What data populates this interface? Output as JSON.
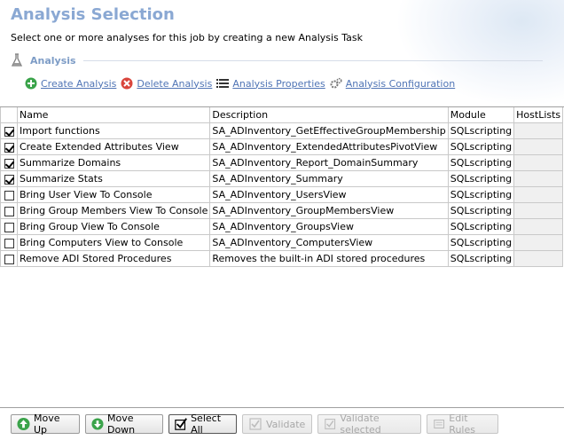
{
  "header": {
    "title": "Analysis Selection",
    "subtitle": "Select one or more analyses for this job by creating a new Analysis Task"
  },
  "section": {
    "label": "Analysis"
  },
  "toolbar": {
    "create": "Create Analysis",
    "delete": "Delete Analysis",
    "properties": "Analysis Properties",
    "configuration": "Analysis Configuration"
  },
  "grid": {
    "columns": [
      "Name",
      "Description",
      "Module",
      "HostLists"
    ],
    "rows": [
      {
        "checked": true,
        "name": "Import functions",
        "description": "SA_ADInventory_GetEffectiveGroupMembership",
        "module": "SQLscripting",
        "hostlists": ""
      },
      {
        "checked": true,
        "name": "Create Extended Attributes View",
        "description": "SA_ADInventory_ExtendedAttributesPivotView",
        "module": "SQLscripting",
        "hostlists": ""
      },
      {
        "checked": true,
        "name": "Summarize Domains",
        "description": "SA_ADInventory_Report_DomainSummary",
        "module": "SQLscripting",
        "hostlists": ""
      },
      {
        "checked": true,
        "name": "Summarize Stats",
        "description": "SA_ADInventory_Summary",
        "module": "SQLscripting",
        "hostlists": ""
      },
      {
        "checked": false,
        "name": "Bring User View To Console",
        "description": "SA_ADInventory_UsersView",
        "module": "SQLscripting",
        "hostlists": ""
      },
      {
        "checked": false,
        "name": "Bring Group Members View To Console",
        "description": "SA_ADInventory_GroupMembersView",
        "module": "SQLscripting",
        "hostlists": ""
      },
      {
        "checked": false,
        "name": "Bring Group View To Console",
        "description": "SA_ADInventory_GroupsView",
        "module": "SQLscripting",
        "hostlists": ""
      },
      {
        "checked": false,
        "name": "Bring Computers View to Console",
        "description": "SA_ADInventory_ComputersView",
        "module": "SQLscripting",
        "hostlists": ""
      },
      {
        "checked": false,
        "name": "Remove ADI Stored Procedures",
        "description": "Removes the built-in ADI stored procedures",
        "module": "SQLscripting",
        "hostlists": ""
      }
    ]
  },
  "buttons": {
    "move_up": "Move Up",
    "move_down": "Move Down",
    "select_all": "Select All",
    "validate": "Validate",
    "validate_selected": "Validate selected",
    "edit_rules": "Edit Rules"
  },
  "colors": {
    "title": "#8aa8d3",
    "link": "#4f74b5",
    "section_label": "#7d9cc6"
  }
}
